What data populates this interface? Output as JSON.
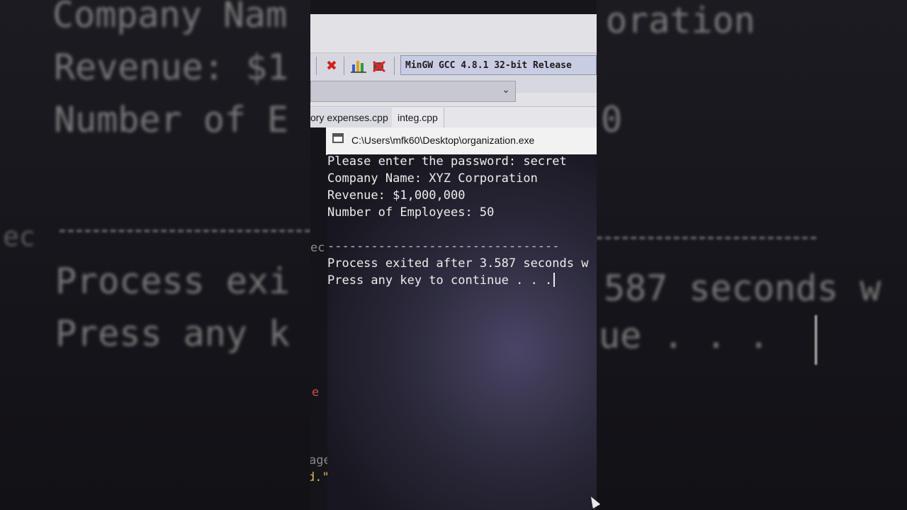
{
  "background": {
    "company_line": "Company Nam",
    "company_tail": "oration",
    "revenue_line": "Revenue: $1",
    "employees_line": "Number of E",
    "employees_tail": "0",
    "sep_prefix": "ec",
    "process_line": "Process exi",
    "process_tail": "587 seconds w",
    "press_line": "Press any k",
    "press_tail": "ue . . ."
  },
  "toolbar": {
    "compiler": "MinGW GCC 4.8.1 32-bit Release",
    "dropdown_value": "",
    "icons": [
      "close-red-x-icon",
      "chart-icon",
      "bug-delete-icon"
    ]
  },
  "tabs": [
    {
      "label": "ory expenses.cpp"
    },
    {
      "label": "integ.cpp"
    }
  ],
  "ide_fragments": {
    "ec": "ec",
    "e": "e",
    "age": "age",
    "d": "d.\""
  },
  "console": {
    "title": "C:\\Users\\mfk60\\Desktop\\organization.exe",
    "lines": [
      "Please enter the password: secret",
      "Company Name: XYZ Corporation",
      "Revenue: $1,000,000",
      "Number of Employees: 50",
      "",
      "--------------------------------",
      "Process exited after 3.587 seconds w",
      "Press any key to continue . . ."
    ]
  },
  "colors": {
    "console_text": "#ededed",
    "toolbar_bg": "#e2e2e6",
    "compiler_bg": "#c9cde3",
    "close_icon": "#d21f1f"
  }
}
